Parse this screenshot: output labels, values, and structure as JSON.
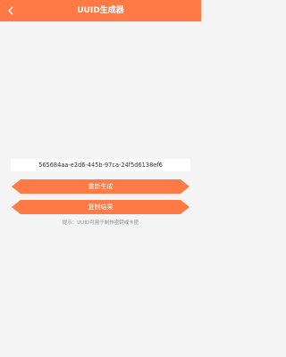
{
  "app_bar": {
    "title": "UUID生成器",
    "back_icon": "back-arrow-icon"
  },
  "uuid": {
    "value": "565684aa-e2d6-445b-97ca-24f5d6138ef6"
  },
  "buttons": {
    "regenerate_label": "重新生成",
    "copy_label": "复制结果"
  },
  "hint": "提示：UUID可用于制作密钥或卡密",
  "colors": {
    "accent": "#ff7a45",
    "background": "#f4f4f4",
    "card": "#ffffff"
  }
}
